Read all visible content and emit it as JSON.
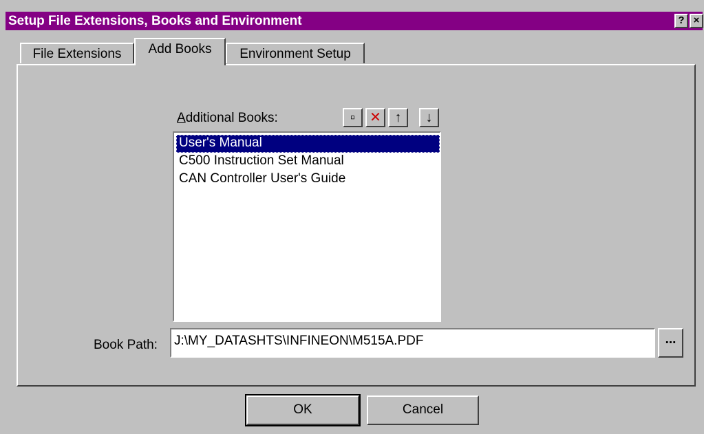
{
  "window": {
    "title": "Setup File Extensions, Books and Environment",
    "help_label": "?",
    "close_label": "×"
  },
  "tabs": [
    {
      "label": "File Extensions",
      "active": false
    },
    {
      "label": "Add Books",
      "active": true
    },
    {
      "label": "Environment Setup",
      "active": false
    }
  ],
  "books": {
    "label_accel": "A",
    "label_rest": "dditional Books:",
    "toolbar": {
      "new_icon": "new-folder-icon",
      "delete_icon": "delete-icon",
      "up_icon": "arrow-up-icon",
      "down_icon": "arrow-down-icon",
      "new_glyph": "▫",
      "delete_glyph": "✕",
      "up_glyph": "↑",
      "down_glyph": "↓"
    },
    "items": [
      {
        "label": "User's Manual",
        "selected": true
      },
      {
        "label": "C500 Instruction Set Manual",
        "selected": false
      },
      {
        "label": "CAN Controller User's Guide",
        "selected": false
      }
    ]
  },
  "book_path": {
    "label": "Book Path:",
    "value": "J:\\MY_DATASHTS\\INFINEON\\M515A.PDF",
    "browse_label": "..."
  },
  "buttons": {
    "ok": "OK",
    "cancel": "Cancel"
  },
  "colors": {
    "title_bar": "#840084",
    "selection": "#000080",
    "face": "#c0c0c0"
  }
}
